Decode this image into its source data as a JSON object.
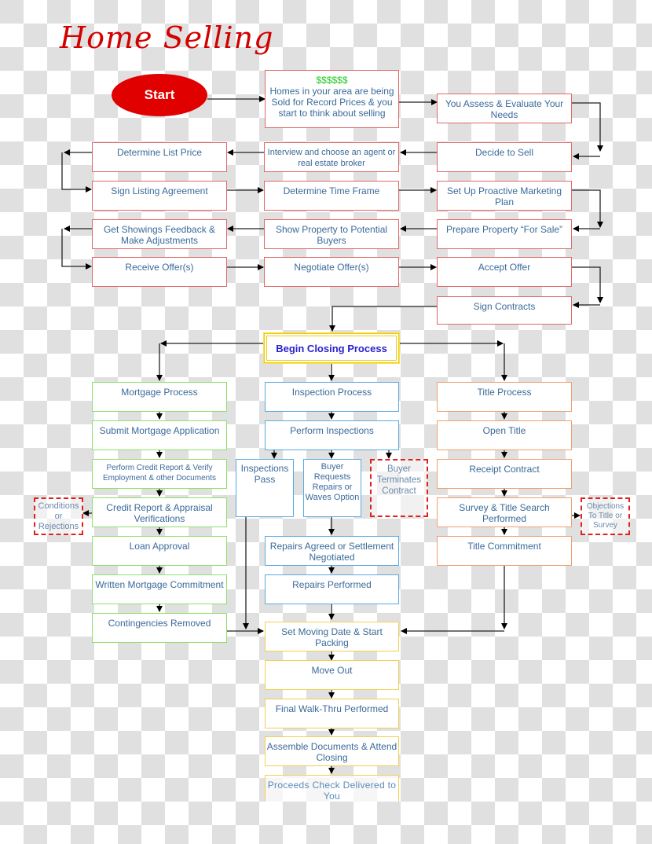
{
  "title": "Home Selling",
  "start_label": "Start",
  "selling_phase": {
    "intro_box": {
      "highlight": "$$$$$$",
      "text": "Homes in your area are being Sold for Record Prices & you start to think about selling"
    },
    "steps": [
      "You Assess & Evaluate Your Needs",
      "Decide to Sell",
      "Interview and choose an agent or real estate broker",
      "Determine List Price",
      "Sign Listing Agreement",
      "Determine Time Frame",
      "Set Up Proactive Marketing Plan",
      "Prepare Property “For Sale”",
      "Show Property to Potential Buyers",
      "Get Showings Feedback & Make Adjustments",
      "Receive Offer(s)",
      "Negotiate Offer(s)",
      "Accept Offer",
      "Sign Contracts"
    ]
  },
  "closing": {
    "label": "Begin Closing Process",
    "mortgage": {
      "steps": [
        "Mortgage Process",
        "Submit Mortgage Application",
        "Perform Credit Report & Verify Employment & other Documents",
        "Credit Report & Appraisal Verifications",
        "Loan Approval",
        "Written Mortgage Commitment",
        "Contingencies Removed"
      ],
      "side_note": "Conditions or Rejections"
    },
    "inspection": {
      "steps": [
        "Inspection Process",
        "Perform Inspections"
      ],
      "branches": [
        "Inspections Pass",
        "Buyer Requests Repairs or Waves Option",
        "Buyer Terminates Contract"
      ],
      "after": [
        "Repairs Agreed or Settlement Negotiated",
        "Repairs Performed"
      ]
    },
    "title": {
      "steps": [
        "Title Process",
        "Open Title",
        "Receipt Contract",
        "Survey & Title Search Performed",
        "Title Commitment"
      ],
      "side_note": "Objections To Title or Survey"
    },
    "final_steps": [
      "Set Moving Date & Start Packing",
      "Move Out",
      "Final Walk-Thru Performed",
      "Assemble Documents & Attend Closing",
      "Proceeds Check Delivered to You"
    ]
  },
  "colors": {
    "title": "#d40000",
    "start": "#e00000",
    "selling_border": "#e06868",
    "mortgage_border": "#8ee06a",
    "inspection_border": "#5aaae0",
    "title_border": "#f0a070",
    "final_border": "#f2d050",
    "closing_border": "#f2cc00",
    "text": "#3a6a9a"
  }
}
